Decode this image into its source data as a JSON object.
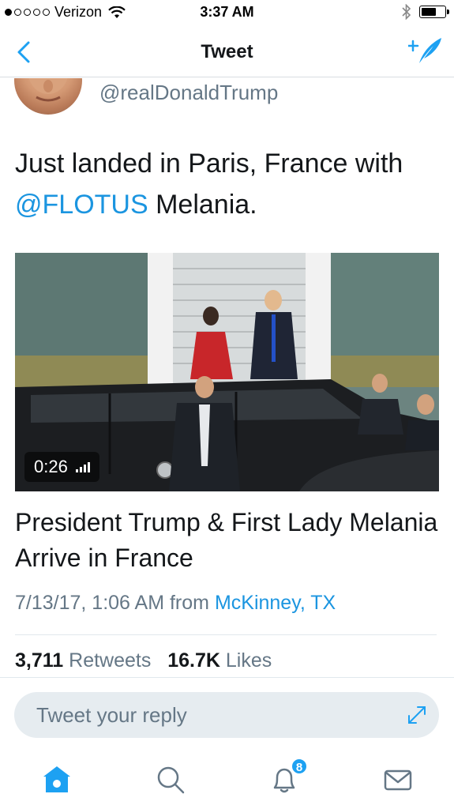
{
  "status_bar": {
    "carrier": "Verizon",
    "time": "3:37 AM",
    "signal_filled": 1,
    "signal_total": 5,
    "battery_level": 0.6
  },
  "nav": {
    "title": "Tweet",
    "back_icon": "chevron-left-icon",
    "compose_icon": "compose-quill-icon",
    "accent_color": "#1da1f2"
  },
  "tweet": {
    "handle": "@realDonaldTrump",
    "text_before": "Just landed in Paris, France with",
    "mention": "@FLOTUS",
    "text_after": " Melania.",
    "media": {
      "duration": "0:26",
      "progress": 0
    },
    "card_title": "President Trump & First Lady Melania Arrive in France",
    "timestamp": "7/13/17, 1:06 AM",
    "from_label": "from",
    "location": "McKinney, TX",
    "retweets_count": "3,711",
    "retweets_label": "Retweets",
    "likes_count": "16.7K",
    "likes_label": "Likes"
  },
  "reply": {
    "placeholder": "Tweet your reply"
  },
  "tabs": {
    "home_icon": "home-icon",
    "search_icon": "search-icon",
    "notifications_icon": "bell-icon",
    "notifications_badge": "8",
    "messages_icon": "envelope-icon"
  }
}
